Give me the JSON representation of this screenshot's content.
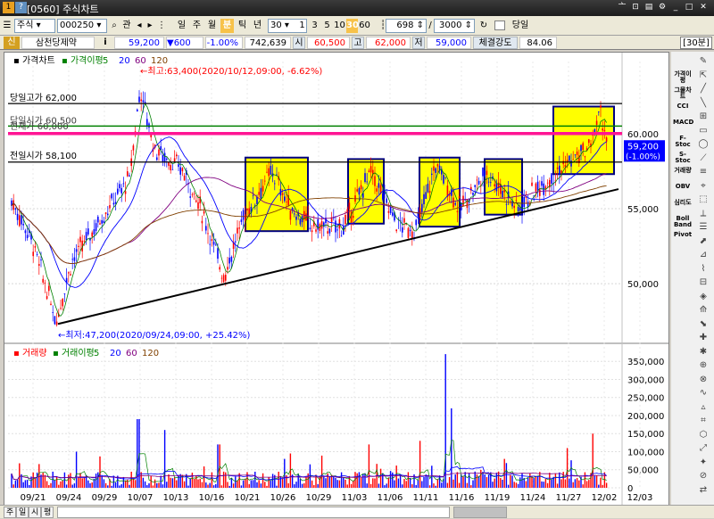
{
  "window": {
    "screen_id": "[0560]",
    "title": "주식차트"
  },
  "toolbar": {
    "market": "주식",
    "code": "000250",
    "relation_btn": "관",
    "periods": [
      "일",
      "주",
      "월",
      "분",
      "틱",
      "년"
    ],
    "active_period": "분",
    "interval": "30",
    "quick_intervals": [
      "1",
      "3",
      "5",
      "10",
      "30",
      "60"
    ],
    "active_interval": "30",
    "display_count": "698",
    "total_count": "3000",
    "today_label": "당일"
  },
  "quote": {
    "badge": "신",
    "name": "삼천당제약",
    "info_btn": "i",
    "price": "59,200",
    "change": "▼600",
    "change_rate": "-1.00%",
    "volume": "742,639",
    "open_label": "시",
    "open": "60,500",
    "high_label": "고",
    "high": "62,000",
    "low_label": "저",
    "low": "59,000",
    "strength_label": "체결강도",
    "strength": "84.06",
    "interval_badge": "[30분]"
  },
  "price_panel": {
    "legend": {
      "title": "가격차트",
      "ma_label": "가격이평",
      "ma_periods": [
        "5",
        "20",
        "60",
        "120"
      ]
    },
    "lines": {
      "day_high": "당일고가 62,000",
      "day_open": "당일시가 60,500",
      "overlap": "현재가 60,000",
      "prev_open": "전일시가 58,100"
    },
    "max_label": "←최고:63,400(2020/10/12,09:00, -6.62%)",
    "min_label": "←최저:47,200(2020/09/24,09:00, +25.42%)",
    "y_ticks": [
      "60,000",
      "55,000",
      "50,000"
    ],
    "cur_price_tag": "59,200",
    "cur_rate_tag": "(-1.00%)"
  },
  "volume_panel": {
    "legend": {
      "title": "거래량",
      "ma_label": "거래이평",
      "ma_periods": [
        "5",
        "20",
        "60",
        "120"
      ]
    },
    "y_ticks": [
      "350,000",
      "300,000",
      "250,000",
      "200,000",
      "150,000",
      "100,000",
      "50,000",
      "0"
    ]
  },
  "x_ticks": [
    "09/21",
    "09/24",
    "09/29",
    "10/07",
    "10/13",
    "10/16",
    "10/21",
    "10/26",
    "10/29",
    "11/03",
    "11/06",
    "11/11",
    "11/16",
    "11/19",
    "11/24",
    "11/27",
    "12/02",
    "12/03"
  ],
  "right_toolbar": [
    "가격이평",
    "그물차트",
    "CCI",
    "MACD",
    "F-Stoc",
    "S-Stoc",
    "거래량",
    "OBV",
    "심리도",
    "Boll Band",
    "Pivot"
  ],
  "status_tabs": [
    "주",
    "일",
    "시",
    "평"
  ],
  "colors": {
    "up": "#ff0000",
    "down": "#0000ff",
    "highlight": "#ffff00",
    "pink_line": "#ff1493",
    "green_line": "#008000",
    "ma5": "#008000",
    "ma20": "#0000ff",
    "ma60": "#800080",
    "ma120": "#804000"
  }
}
